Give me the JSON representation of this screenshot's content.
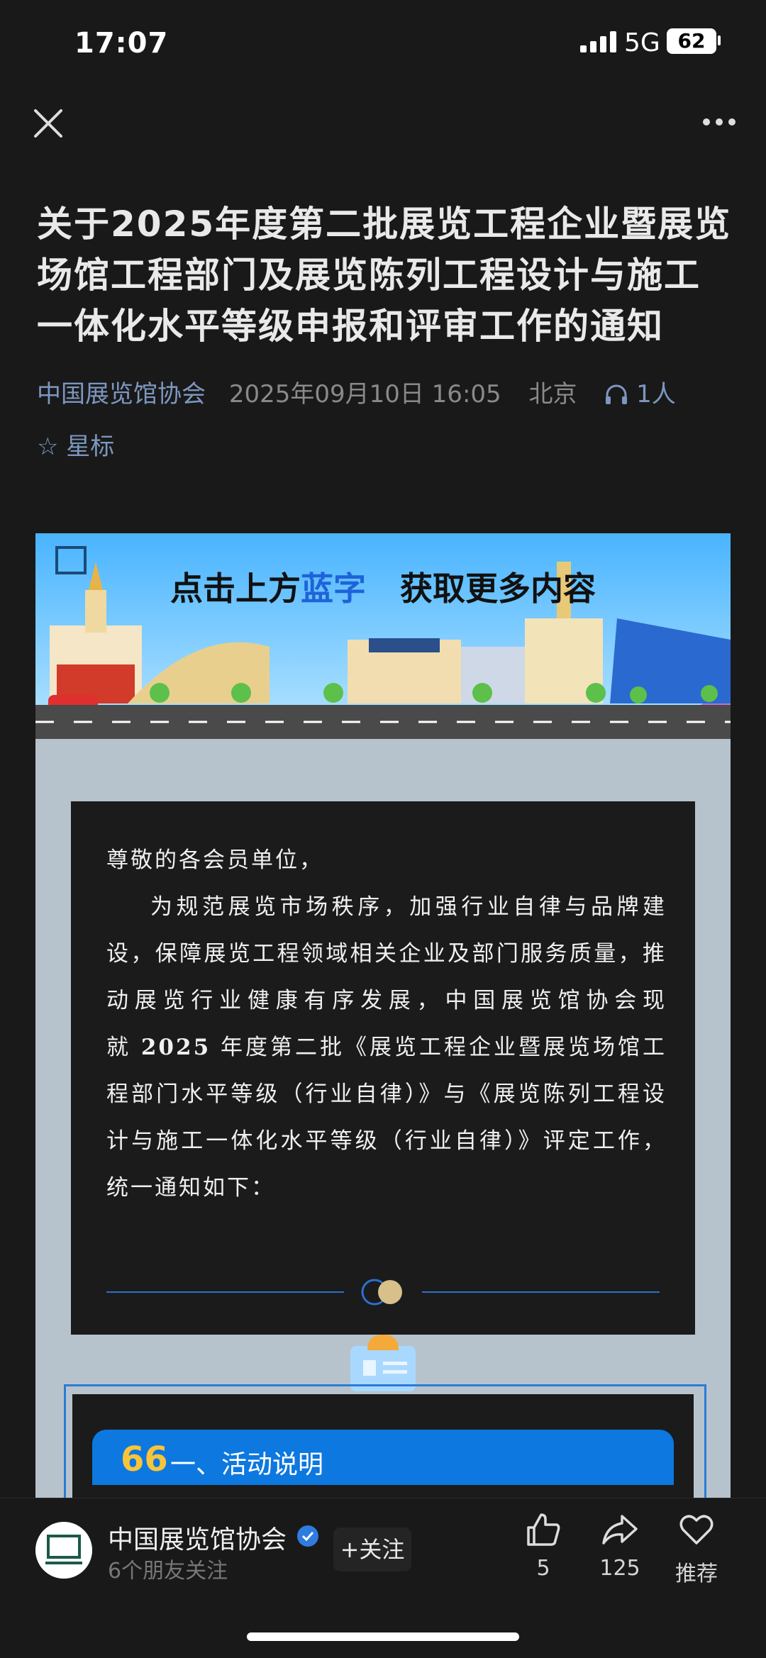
{
  "status": {
    "time": "17:07",
    "network": "5G",
    "battery": "62"
  },
  "nav": {
    "close_icon": "close-icon",
    "more_icon": "more-dots-icon"
  },
  "article": {
    "title": "关于2025年度第二批展览工程企业暨展览场馆工程部门及展览陈列工程设计与施工一体化水平等级申报和评审工作的通知",
    "account": "中国展览馆协会",
    "datetime": "2025年09月10日 16:05",
    "location": "北京",
    "listeners": "1人",
    "star_label": "星标"
  },
  "banner": {
    "text_before": "点击上方",
    "text_blue": "蓝字",
    "text_after": "获取更多内容"
  },
  "notice": {
    "greeting": "尊敬的各会员单位，",
    "paragraph_before": "为规范展览市场秩序，加强行业自律与品牌建设，保障展览工程领域相关企业及部门服务质量，推动展览行业健康有序发展，中国展览馆协会现就",
    "year": "2025",
    "paragraph_after": "年度第二批《展览工程企业暨展览场馆工程部门水平等级（行业自律）》与《展览陈列工程设计与施工一体化水平等级（行业自律）》评定工作，统一通知如下："
  },
  "section": {
    "quote": "66",
    "title": "一、活动说明"
  },
  "bottom": {
    "account": "中国展览馆协会",
    "followers": "6个朋友关注",
    "follow_label": "+关注",
    "like_count": "5",
    "share_count": "125",
    "recommend_label": "推荐"
  },
  "colors": {
    "accent": "#7d97bf",
    "section_blue": "#0d78e0",
    "background": "#191919"
  }
}
